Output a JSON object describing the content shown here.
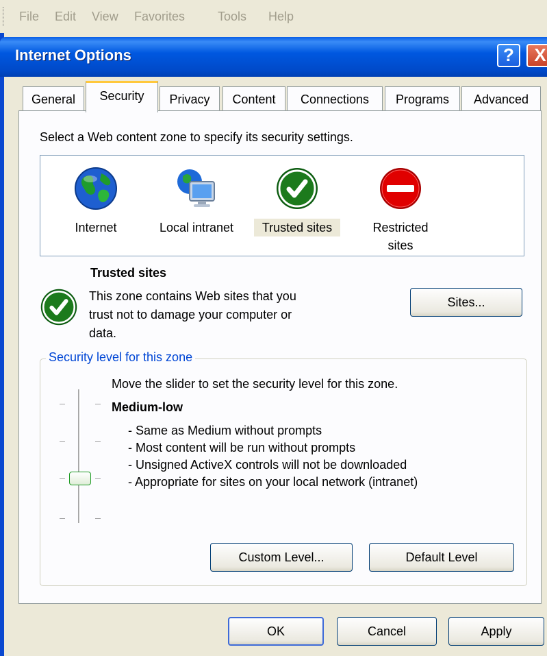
{
  "menu": [
    "File",
    "Edit",
    "View",
    "Favorites",
    "Tools",
    "Help"
  ],
  "window": {
    "title": "Internet Options",
    "help_glyph": "?",
    "close_glyph": "X"
  },
  "tabs": [
    {
      "label": "General",
      "active": false
    },
    {
      "label": "Security",
      "active": true
    },
    {
      "label": "Privacy",
      "active": false
    },
    {
      "label": "Content",
      "active": false
    },
    {
      "label": "Connections",
      "active": false
    },
    {
      "label": "Programs",
      "active": false
    },
    {
      "label": "Advanced",
      "active": false
    }
  ],
  "security": {
    "instruction": "Select a Web content zone to specify its security settings.",
    "zones": [
      {
        "label": "Internet",
        "icon": "globe-icon"
      },
      {
        "label": "Local intranet",
        "icon": "intranet-icon"
      },
      {
        "label": "Trusted sites",
        "icon": "checkmark-icon",
        "selected": true
      },
      {
        "label": "Restricted sites",
        "label_line1": "Restricted",
        "label_line2": "sites",
        "icon": "no-entry-icon"
      }
    ],
    "selected_zone": {
      "title": "Trusted sites",
      "description_line1": "This zone contains Web sites that you",
      "description_line2": "trust not to damage your computer or",
      "description_line3": "data."
    },
    "sites_button": "Sites...",
    "level_group": {
      "legend": "Security level for this zone",
      "hint": "Move the slider to set the security level for this zone.",
      "level_name": "Medium-low",
      "bullets": [
        "- Same as Medium without prompts",
        "- Most content will be run without prompts",
        "- Unsigned ActiveX controls will not be downloaded",
        "- Appropriate for sites on your local network (intranet)"
      ],
      "custom_button": "Custom Level...",
      "default_button": "Default Level"
    }
  },
  "footer": {
    "ok": "OK",
    "cancel": "Cancel",
    "apply": "Apply"
  },
  "colors": {
    "titlebar": "#0058e0",
    "window_bg": "#ece9d8",
    "legend": "#0046d5",
    "trusted_green": "#1c7a1c",
    "restricted_red": "#e00000"
  }
}
